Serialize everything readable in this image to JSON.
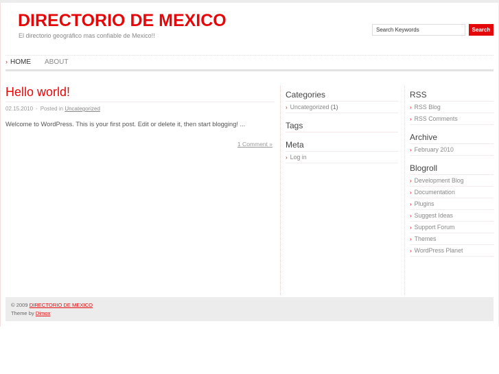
{
  "header": {
    "site_title": "DIRECTORIO DE MEXICO",
    "site_description": "El directorio geográfico mas confiable de Mexico!!",
    "search": {
      "value": "Search Keywords",
      "button_label": "Search"
    }
  },
  "nav": {
    "items": [
      {
        "label": "HOME",
        "active": true
      },
      {
        "label": "ABOUT",
        "active": false
      }
    ],
    "arrow": "›"
  },
  "post": {
    "title": "Hello world!",
    "date": "02.15.2010",
    "separator": "·",
    "posted_in_label": "Posted in",
    "category": "Uncategorized",
    "excerpt": "Welcome to WordPress. This is your first post. Edit or delete it, then start blogging! ...",
    "comments_link": "1 Comment »"
  },
  "sidebar_middle": {
    "widgets": [
      {
        "title": "Categories",
        "items": [
          {
            "label": "Uncategorized",
            "count": "(1)"
          }
        ]
      },
      {
        "title": "Tags",
        "items": []
      },
      {
        "title": "Meta",
        "items": [
          {
            "label": "Log in"
          }
        ]
      }
    ]
  },
  "sidebar_right": {
    "widgets": [
      {
        "title": "RSS",
        "items": [
          {
            "label": "RSS Blog"
          },
          {
            "label": "RSS Comments"
          }
        ]
      },
      {
        "title": "Archive",
        "items": [
          {
            "label": "February 2010"
          }
        ]
      },
      {
        "title": "Blogroll",
        "items": [
          {
            "label": "Development Blog"
          },
          {
            "label": "Documentation"
          },
          {
            "label": "Plugins"
          },
          {
            "label": "Suggest Ideas"
          },
          {
            "label": "Support Forum"
          },
          {
            "label": "Themes"
          },
          {
            "label": "WordPress Planet"
          }
        ]
      }
    ]
  },
  "footer": {
    "copyright": "© 2009",
    "site_link": "DIRECTORIO DE MEXICO",
    "theme_by_label": "Theme by",
    "theme_author": "Dimox"
  },
  "colors": {
    "accent": "#e4080a",
    "footer_bg": "#ececec"
  }
}
